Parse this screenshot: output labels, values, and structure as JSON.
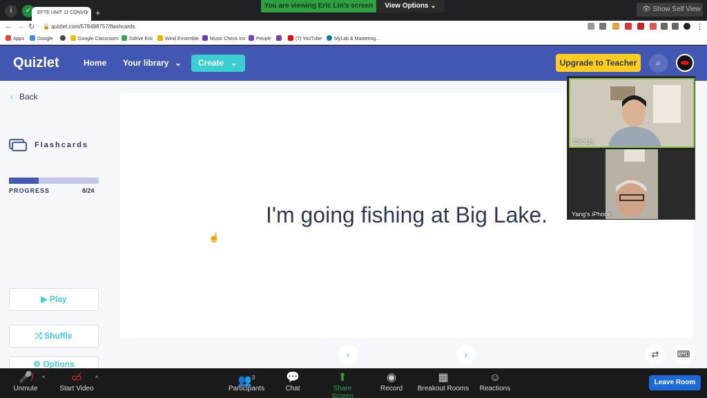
{
  "browser": {
    "tab_title": "EFTE UNIT 11 CONVO",
    "tab_close": "×",
    "new_tab": "+",
    "url": "quizlet.com/578498757/flashcards",
    "bookmarks": [
      "Apps",
      "Google",
      "Google Classroom",
      "Gdrive Eric",
      "Wind Ensemble",
      "Music Check Ins",
      "People",
      "(7) YouTube",
      "MyLab & Mastering..."
    ]
  },
  "zoom_top": {
    "banner": "You are viewing Eric Lin's screen",
    "view_options": "View Options ⌄",
    "self_view": "Show Self View"
  },
  "quizlet": {
    "logo": "Quizlet",
    "home": "Home",
    "library": "Your library",
    "create": "Create",
    "upgrade": "Upgrade to Teacher",
    "brand_color": "#4257b2",
    "accent_color": "#3ccfcf"
  },
  "sidebar": {
    "back": "Back",
    "mode": "Flashcards",
    "progress_label": "PROGRESS",
    "progress_text": "8/24",
    "progress_fraction": 0.333,
    "play": "▶ Play",
    "shuffle": "⤮ Shuffle",
    "options": "Options"
  },
  "card": {
    "term": "I'm going fishing at Big Lake."
  },
  "video": {
    "p1": "Eric Lin",
    "p2": "Yang's iPhone"
  },
  "zoom_bar": {
    "unmute": "Unmute",
    "start_video": "Start Video",
    "participants": "Participants",
    "participant_count": "3",
    "chat": "Chat",
    "share": "Share Screen",
    "record": "Record",
    "breakout": "Breakout Rooms",
    "reactions": "Reactions",
    "leave": "Leave Room"
  }
}
